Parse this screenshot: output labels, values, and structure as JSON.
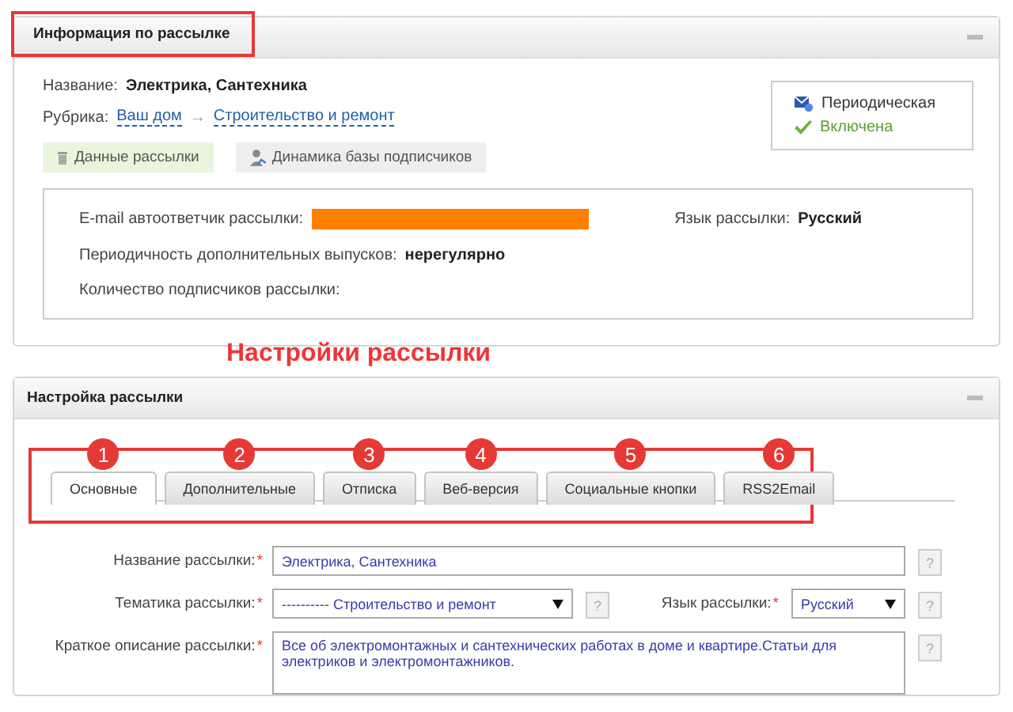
{
  "info_panel": {
    "title": "Информация по рассылке",
    "name_label": "Название:",
    "name_value": "Электрика, Сантехника",
    "rubric_label": "Рубрика:",
    "rubric_path": [
      "Ваш дом",
      "Строительство и ремонт"
    ],
    "rubric_separator": "→",
    "tabs": [
      {
        "label": "Данные рассылки",
        "selected": true
      },
      {
        "label": "Динамика базы подписчиков",
        "selected": false
      }
    ],
    "status": {
      "type": "Периодическая",
      "state": "Включена",
      "enabled": true
    },
    "details": {
      "autoresponder_label": "E-mail автоответчик рассылки:",
      "language_label": "Язык рассылки:",
      "language_value": "Русский",
      "periodicity_label": "Периодичность дополнительных выпусков:",
      "periodicity_value": "нерегулярно",
      "subscribers_label": "Количество подписчиков рассылки:"
    }
  },
  "annotation_heading": "Настройки рассылки",
  "settings_panel": {
    "title": "Настройка рассылки",
    "tabs": [
      {
        "label": "Основные",
        "number": "1",
        "selected": true
      },
      {
        "label": "Дополнительные",
        "number": "2",
        "selected": false
      },
      {
        "label": "Отписка",
        "number": "3",
        "selected": false
      },
      {
        "label": "Веб-версия",
        "number": "4",
        "selected": false
      },
      {
        "label": "Социальные кнопки",
        "number": "5",
        "selected": false
      },
      {
        "label": "RSS2Email",
        "number": "6",
        "selected": false
      }
    ],
    "form": {
      "required_mark": "*",
      "help": "?",
      "name_label": "Название рассылки:",
      "name_value": "Электрика, Сантехника",
      "topic_label": "Тематика рассылки:",
      "topic_value": "---------- Строительство и ремонт",
      "language_label": "Язык рассылки:",
      "language_value": "Русский",
      "description_label": "Краткое описание рассылки:",
      "description_value": "Все об электромонтажных и сантехнических работах в доме и квартире.Статьи для электриков и электромонтажников."
    }
  }
}
